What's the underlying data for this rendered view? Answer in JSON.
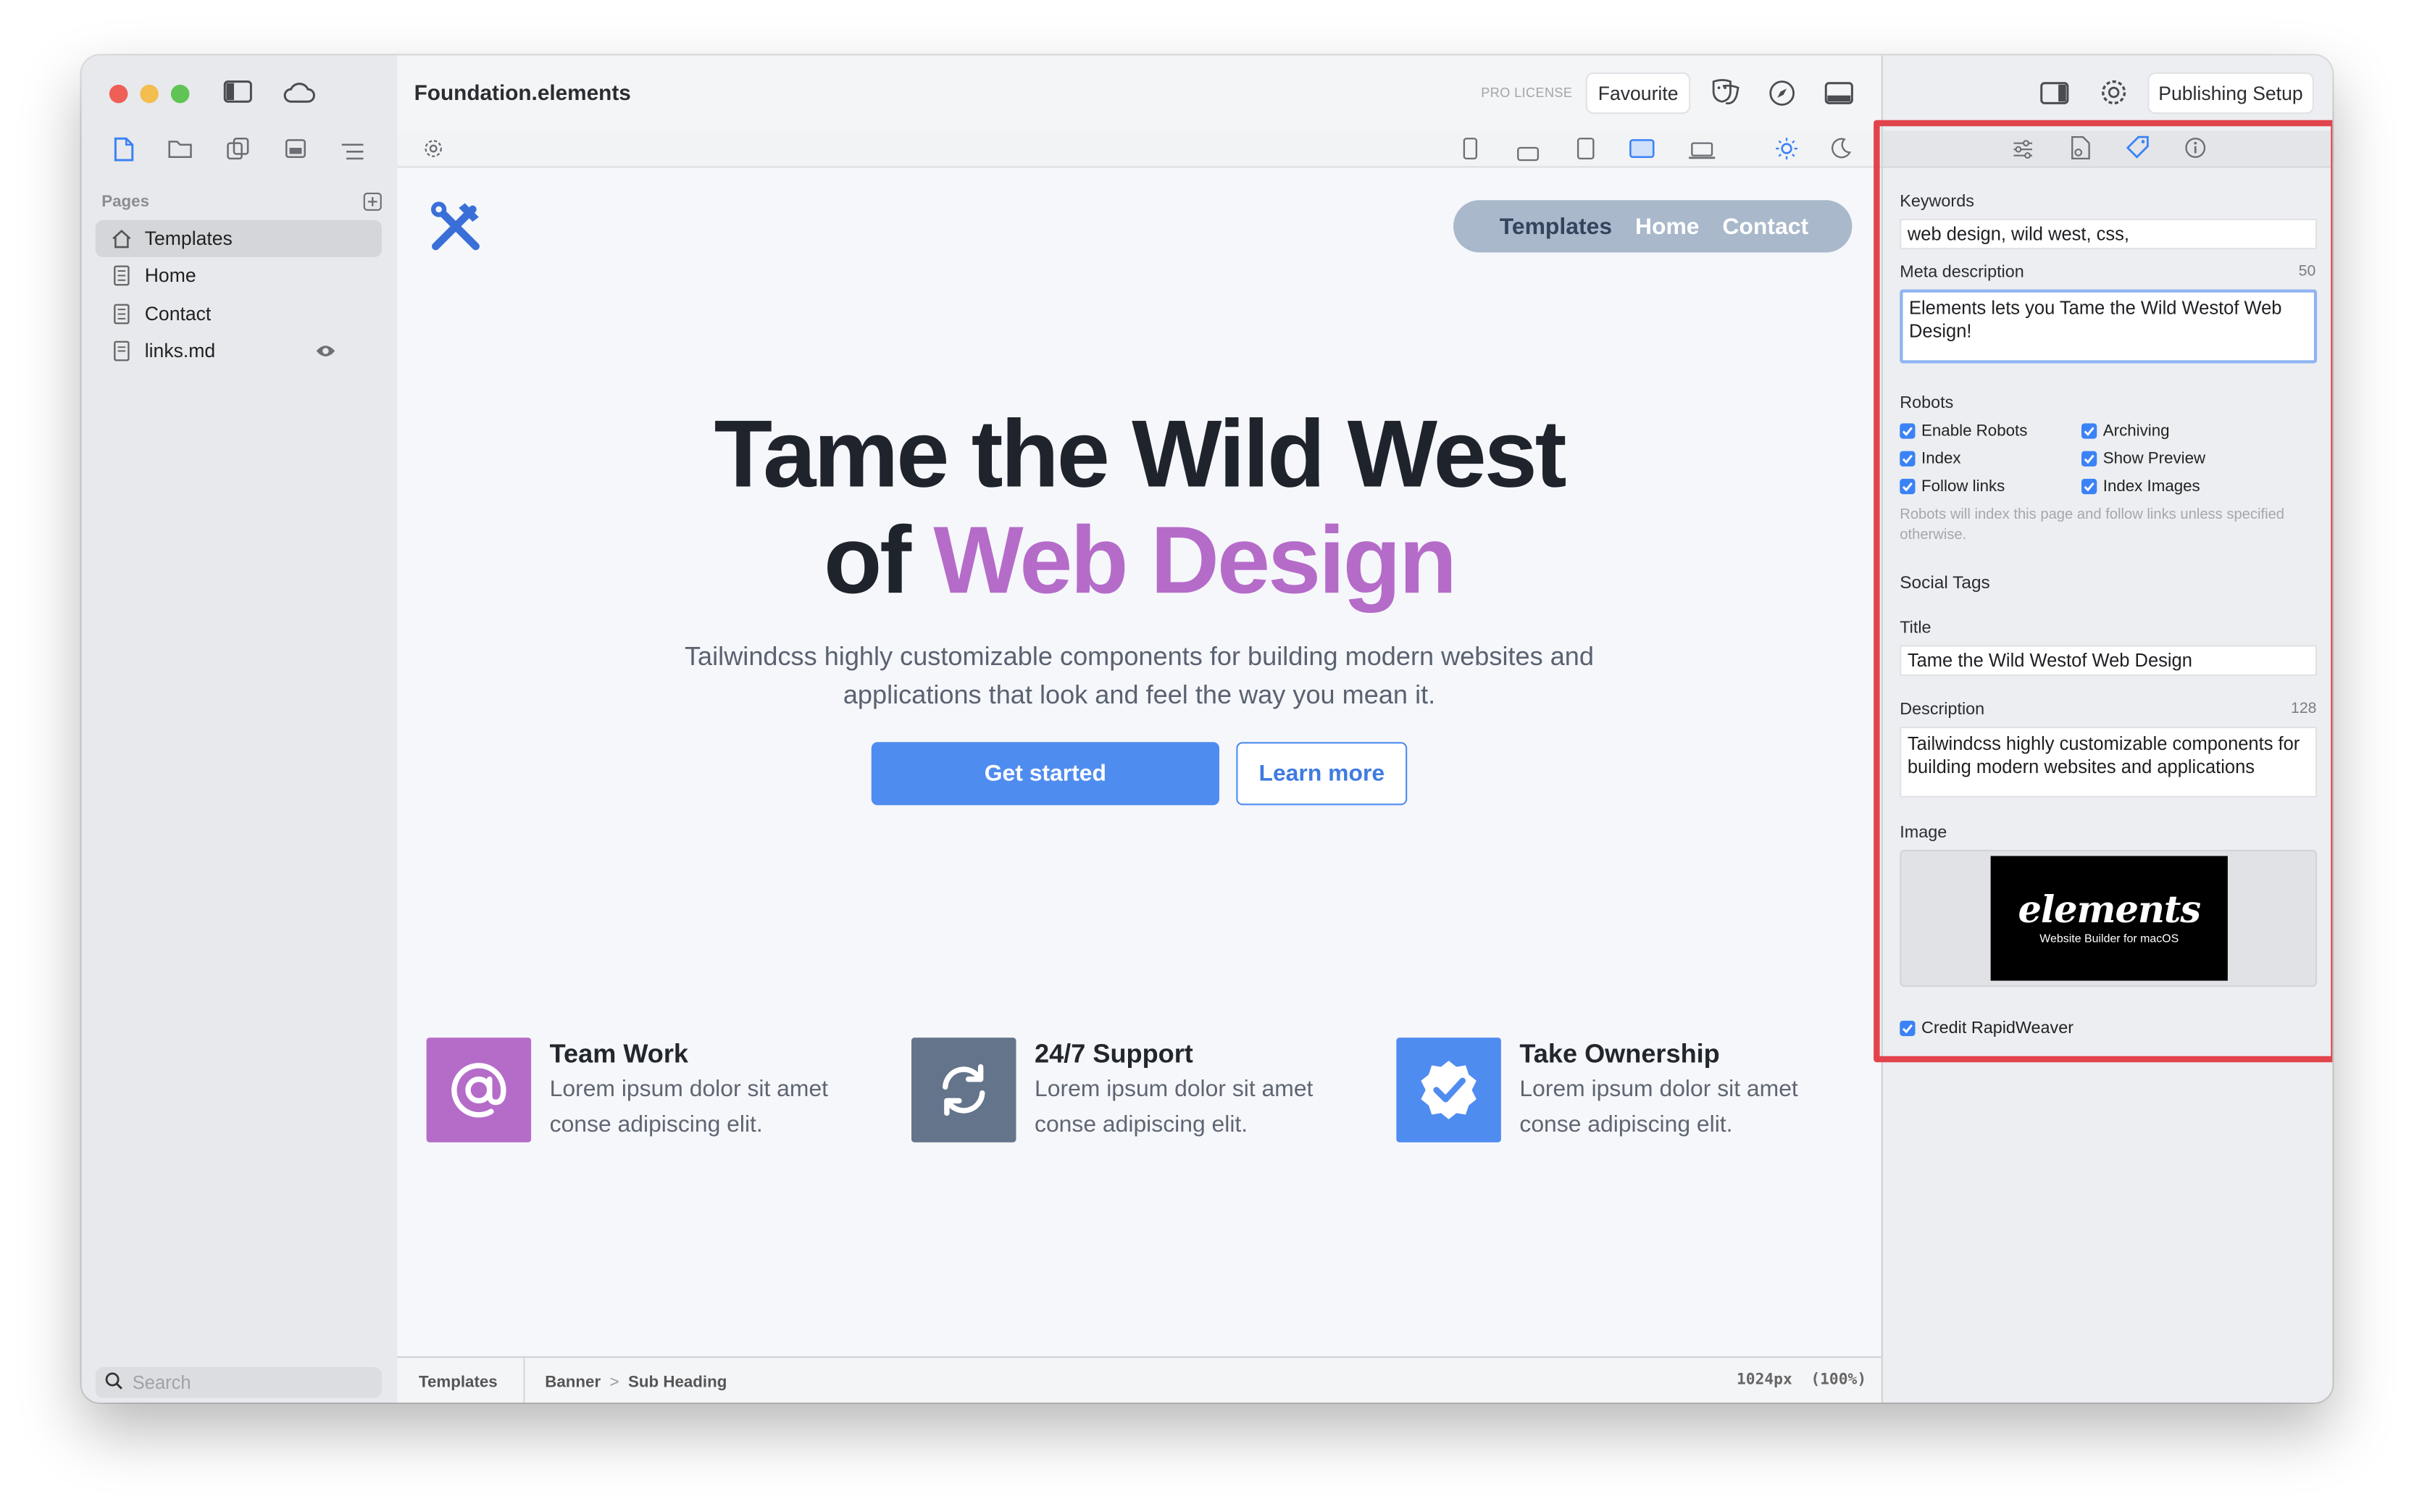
{
  "window": {
    "title": "Foundation.elements"
  },
  "titlebar": {
    "license": "PRO LICENSE",
    "favourite": "Favourite",
    "publishing": "Publishing Setup"
  },
  "sidebar": {
    "section": "Pages",
    "items": [
      {
        "label": "Templates",
        "icon": "home-icon"
      },
      {
        "label": "Home",
        "icon": "page-icon"
      },
      {
        "label": "Contact",
        "icon": "page-icon"
      },
      {
        "label": "links.md",
        "icon": "document-icon"
      }
    ],
    "search_placeholder": "Search"
  },
  "preview": {
    "nav": [
      "Templates",
      "Home",
      "Contact"
    ],
    "headline_line1": "Tame the Wild West",
    "headline_of": "of ",
    "headline_accent": "Web Design",
    "subheading_line1": "Tailwindcss highly customizable components for building modern websites and",
    "subheading_line2": "applications that look and feel the way you mean it.",
    "primary_button": "Get started",
    "secondary_button": "Learn more",
    "features": [
      {
        "title": "Team Work",
        "line1": "Lorem ipsum dolor sit amet",
        "line2": "conse adipiscing elit.",
        "color": "#b56cc9"
      },
      {
        "title": "24/7 Support",
        "line1": "Lorem ipsum dolor sit amet",
        "line2": "conse adipiscing elit.",
        "color": "#64748b"
      },
      {
        "title": "Take Ownership",
        "line1": "Lorem ipsum dolor sit amet",
        "line2": "conse adipiscing elit.",
        "color": "#4f8cf0"
      }
    ]
  },
  "statusbar": {
    "page": "Templates",
    "crumb1": "Banner",
    "sep": ">",
    "crumb2": "Sub Heading",
    "size": "1024px  (100%)"
  },
  "inspector": {
    "keywords_label": "Keywords",
    "keywords_value": "web design, wild west, css,",
    "meta_label": "Meta description",
    "meta_count": "50",
    "meta_value": "Elements lets you Tame the Wild Westof Web Design!",
    "robots_label": "Robots",
    "robots": {
      "enable": "Enable Robots",
      "index": "Index",
      "follow": "Follow links",
      "archiving": "Archiving",
      "preview": "Show Preview",
      "images": "Index Images"
    },
    "robots_hint": "Robots will index this page and follow links unless specified otherwise.",
    "social_label": "Social Tags",
    "title_label": "Title",
    "title_value": "Tame the Wild Westof Web Design",
    "desc_label": "Description",
    "desc_count": "128",
    "desc_value": "Tailwindcss highly customizable components for building modern websites and applications",
    "image_label": "Image",
    "image_logo": "elements",
    "image_tagline": "Website Builder for macOS",
    "credit": "Credit RapidWeaver"
  },
  "colors": {
    "accent": "#b56cc9",
    "primary": "#4f8cf0",
    "highlight": "#e2444b"
  }
}
